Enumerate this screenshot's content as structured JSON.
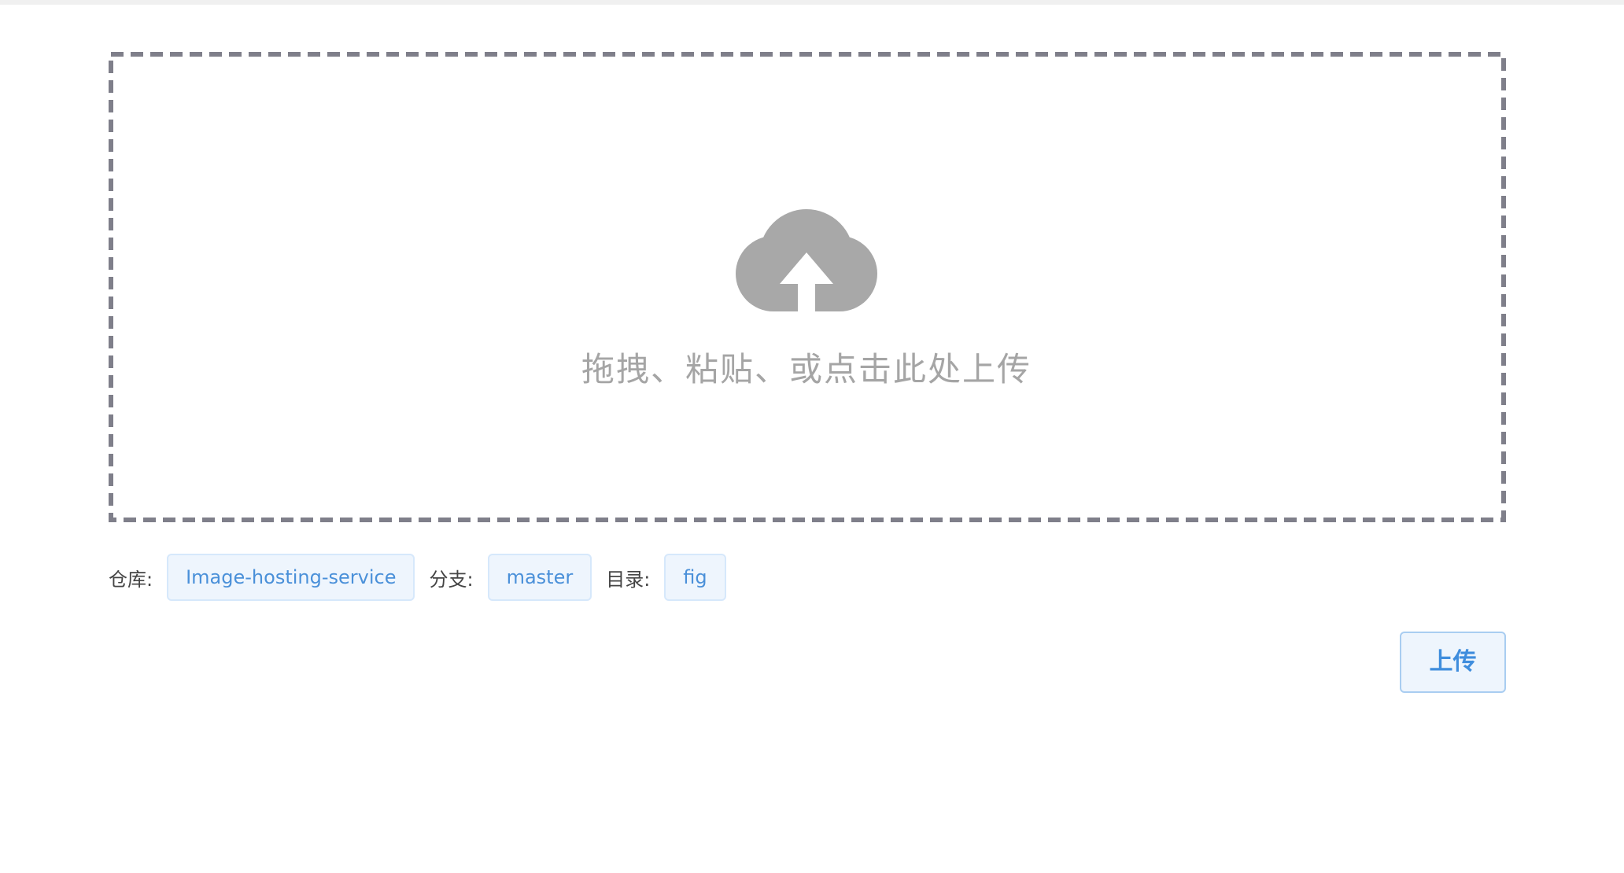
{
  "dropzone": {
    "hint": "拖拽、粘贴、或点击此处上传",
    "icon": "cloud-upload-icon"
  },
  "meta": {
    "repo_label": "仓库:",
    "repo_value": "Image-hosting-service",
    "branch_label": "分支:",
    "branch_value": "master",
    "dir_label": "目录:",
    "dir_value": "fig"
  },
  "actions": {
    "upload_label": "上传"
  },
  "colors": {
    "accent": "#4a90d9",
    "dropzone_border": "#7f7f8a",
    "icon_gray": "#a8a8a8",
    "tag_bg": "#eef5fd"
  }
}
